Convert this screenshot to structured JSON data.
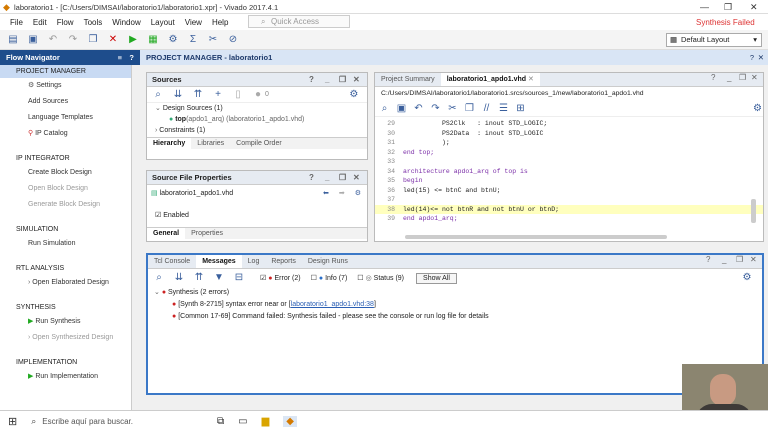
{
  "window": {
    "title": "laboratorio1 - [C:/Users/DIMSAI/laboratorio1/laboratorio1.xpr] - Vivado 2017.4.1",
    "status": "Synthesis Failed"
  },
  "menu": [
    "File",
    "Edit",
    "Flow",
    "Tools",
    "Window",
    "Layout",
    "View",
    "Help"
  ],
  "quick_access": "Quick Access",
  "layout_select": "Default Layout",
  "flow_navigator": {
    "title": "Flow Navigator",
    "sections": [
      {
        "label": "PROJECT MANAGER",
        "items": [
          "Settings",
          "Add Sources",
          "Language Templates",
          "IP Catalog"
        ]
      },
      {
        "label": "IP INTEGRATOR",
        "items": [
          "Create Block Design",
          "Open Block Design",
          "Generate Block Design"
        ]
      },
      {
        "label": "SIMULATION",
        "items": [
          "Run Simulation"
        ]
      },
      {
        "label": "RTL ANALYSIS",
        "items": [
          "Open Elaborated Design"
        ]
      },
      {
        "label": "SYNTHESIS",
        "items": [
          "Run Synthesis",
          "Open Synthesized Design"
        ]
      },
      {
        "label": "IMPLEMENTATION",
        "items": [
          "Run Implementation"
        ]
      }
    ]
  },
  "project_manager_title": "PROJECT MANAGER - laboratorio1",
  "sources": {
    "title": "Sources",
    "count": "0",
    "tree": [
      "Design Sources (1)",
      "top",
      "(apdo1_arq) (laboratorio1_apdo1.vhd)",
      "Constraints (1)"
    ],
    "tabs": [
      "Hierarchy",
      "Libraries",
      "Compile Order"
    ]
  },
  "source_props": {
    "title": "Source File Properties",
    "file": "laboratorio1_apdo1.vhd",
    "enabled": "Enabled",
    "tabs": [
      "General",
      "Properties"
    ]
  },
  "editor": {
    "tabs": [
      "Project Summary",
      "laboratorio1_apdo1.vhd"
    ],
    "path": "C:/Users/DIMSAI/laboratorio1/laboratorio1.srcs/sources_1/new/laboratorio1_apdo1.vhd",
    "lines": [
      {
        "n": "29",
        "text": "          PS2Clk   : inout STD_LOGIC;"
      },
      {
        "n": "30",
        "text": "          PS2Data  : inout STD_LOGIC"
      },
      {
        "n": "31",
        "text": "          );"
      },
      {
        "n": "32",
        "text": "end top;"
      },
      {
        "n": "33",
        "text": ""
      },
      {
        "n": "34",
        "text": "architecture apdo1_arq of top is"
      },
      {
        "n": "35",
        "text": "begin"
      },
      {
        "n": "36",
        "text": "led(15) <= btnC and btnU;"
      },
      {
        "n": "37",
        "text": ""
      },
      {
        "n": "38",
        "text": "led(14)<= not btnR and not btnU or btnD;"
      },
      {
        "n": "39",
        "text": "end apdo1_arq;"
      }
    ]
  },
  "messages": {
    "tabs": [
      "Tcl Console",
      "Messages",
      "Log",
      "Reports",
      "Design Runs"
    ],
    "filters": {
      "error": "Error (2)",
      "info": "Info (7)",
      "status": "Status (9)",
      "show_all": "Show All"
    },
    "group": "Synthesis (2 errors)",
    "items": [
      {
        "pre": "[Synth 8-2715] syntax error near or [",
        "link": "laboratorio1_apdo1.vhd:38",
        "post": "]"
      },
      {
        "pre": "[Common 17-69] Command failed: Synthesis failed - please see the console or run log file for details",
        "link": "",
        "post": ""
      }
    ]
  },
  "taskbar": {
    "search": "Escribe aquí para buscar."
  }
}
